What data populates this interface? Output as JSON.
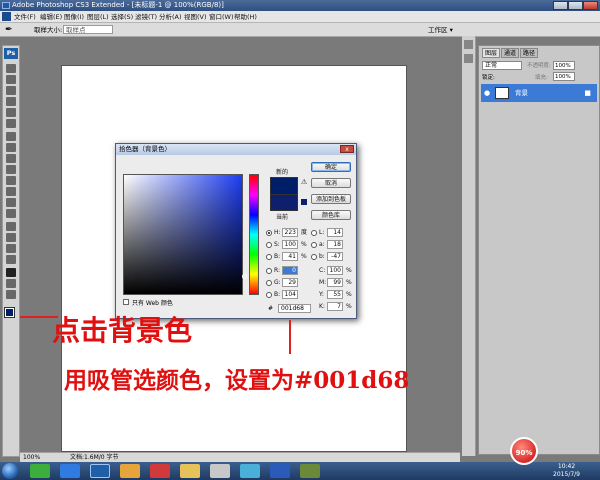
{
  "window": {
    "title": "Adobe Photoshop CS3 Extended - [未标题-1 @ 100%(RGB/8)]"
  },
  "menubar": {
    "items": [
      "文件(F)",
      "编辑(E)",
      "图像(I)",
      "图层(L)",
      "选择(S)",
      "滤镜(T)",
      "分析(A)",
      "视图(V)",
      "窗口(W)",
      "帮助(H)"
    ]
  },
  "options": {
    "sample_size_label": "取样大小:",
    "sample_size_value": "取样点",
    "workspace_label": "工作区 ▾"
  },
  "panels": {
    "tabs": [
      "图层",
      "通道",
      "路径"
    ],
    "blend_mode": "正常",
    "opacity_label": "不透明度:",
    "opacity_value": "100%",
    "lock_label": "锁定:",
    "fill_label": "填充:",
    "fill_value": "100%",
    "layer_name": "背景"
  },
  "statusbar": {
    "zoom": "100%",
    "doc_info": "文档:1.6M/0 字节"
  },
  "picker": {
    "title": "拾色器（背景色）",
    "new_label": "新的",
    "current_label": "当前",
    "buttons": {
      "ok": "确定",
      "cancel": "取消",
      "add_swatch": "添加到色板",
      "libraries": "颜色库"
    },
    "hsb": [
      {
        "label": "H:",
        "value": "223",
        "unit": "度",
        "selected": true
      },
      {
        "label": "S:",
        "value": "100",
        "unit": "%",
        "selected": false
      },
      {
        "label": "B:",
        "value": "41",
        "unit": "%",
        "selected": false
      }
    ],
    "rgb": [
      {
        "label": "R:",
        "value": "0"
      },
      {
        "label": "G:",
        "value": "29"
      },
      {
        "label": "B:",
        "value": "104"
      }
    ],
    "lab": [
      {
        "label": "L:",
        "value": "14"
      },
      {
        "label": "a:",
        "value": "18"
      },
      {
        "label": "b:",
        "value": "-47"
      }
    ],
    "cmyk": [
      {
        "label": "C:",
        "value": "100",
        "unit": "%"
      },
      {
        "label": "M:",
        "value": "99",
        "unit": "%"
      },
      {
        "label": "Y:",
        "value": "55",
        "unit": "%"
      },
      {
        "label": "K:",
        "value": "7",
        "unit": "%"
      }
    ],
    "web_only_label": "只有 Web 颜色",
    "hex_label": "#",
    "hex_value": "001d68"
  },
  "annotations": {
    "line1": "点击背景色",
    "line2": "用吸管选颜色，设置为#001d68"
  },
  "taskbar": {
    "percent_bubble": "90%",
    "clock_time": "10:42",
    "clock_date": "2015/7/9"
  },
  "colors": {
    "foreground_swatch": "#001d68",
    "annotation_red": "#e01010",
    "layer_highlight": "#3b7bd6"
  }
}
